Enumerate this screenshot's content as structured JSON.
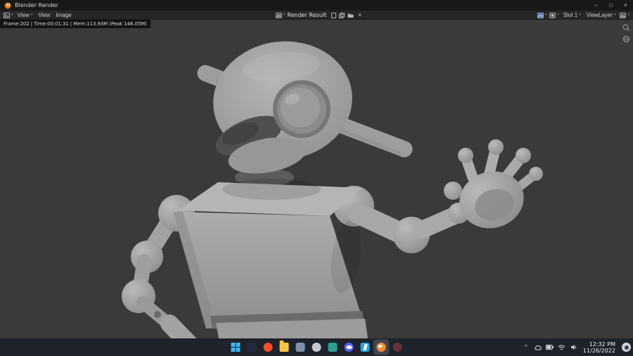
{
  "icons": {
    "dropdown_chevron": "▾",
    "minimize": "–",
    "maximize": "□",
    "close": "×",
    "unlink": "×",
    "tray_chevron": "^"
  },
  "titlebar": {
    "title": "Blender Render"
  },
  "header": {
    "view_dropdown": "View",
    "menus": [
      {
        "label": "View"
      },
      {
        "label": "Image"
      }
    ],
    "image_selector": "Render Result",
    "slot": "Slot 1",
    "view_layer": "ViewLayer"
  },
  "render_info": {
    "stats": "Frame:202 | Time:00:01.31 | Mem:113.93M (Peak 146.05M)"
  },
  "canvas": {
    "background_color": "#3a3a3a",
    "subject_color": "#a6a6a6"
  },
  "taskbar": {
    "apps": [
      {
        "name": "start",
        "color": "#3fb6f0"
      },
      {
        "name": "app-dark",
        "color": "#262a3e"
      },
      {
        "name": "brave",
        "color": "#f4502a"
      },
      {
        "name": "file-explorer",
        "color": "#f8c64a"
      },
      {
        "name": "app-slate",
        "color": "#7e93a8"
      },
      {
        "name": "voice-app",
        "color": "#c2c9d1"
      },
      {
        "name": "app-teal",
        "color": "#2aa08e"
      },
      {
        "name": "discord",
        "color": "#5661f0"
      },
      {
        "name": "vscode",
        "color": "#29a3e3"
      },
      {
        "name": "blender",
        "color": "#ef8f33",
        "active": true
      },
      {
        "name": "app-maroon",
        "color": "#67313a"
      }
    ],
    "tray": {
      "time": "12:32 PM",
      "date": "11/26/2022"
    }
  }
}
